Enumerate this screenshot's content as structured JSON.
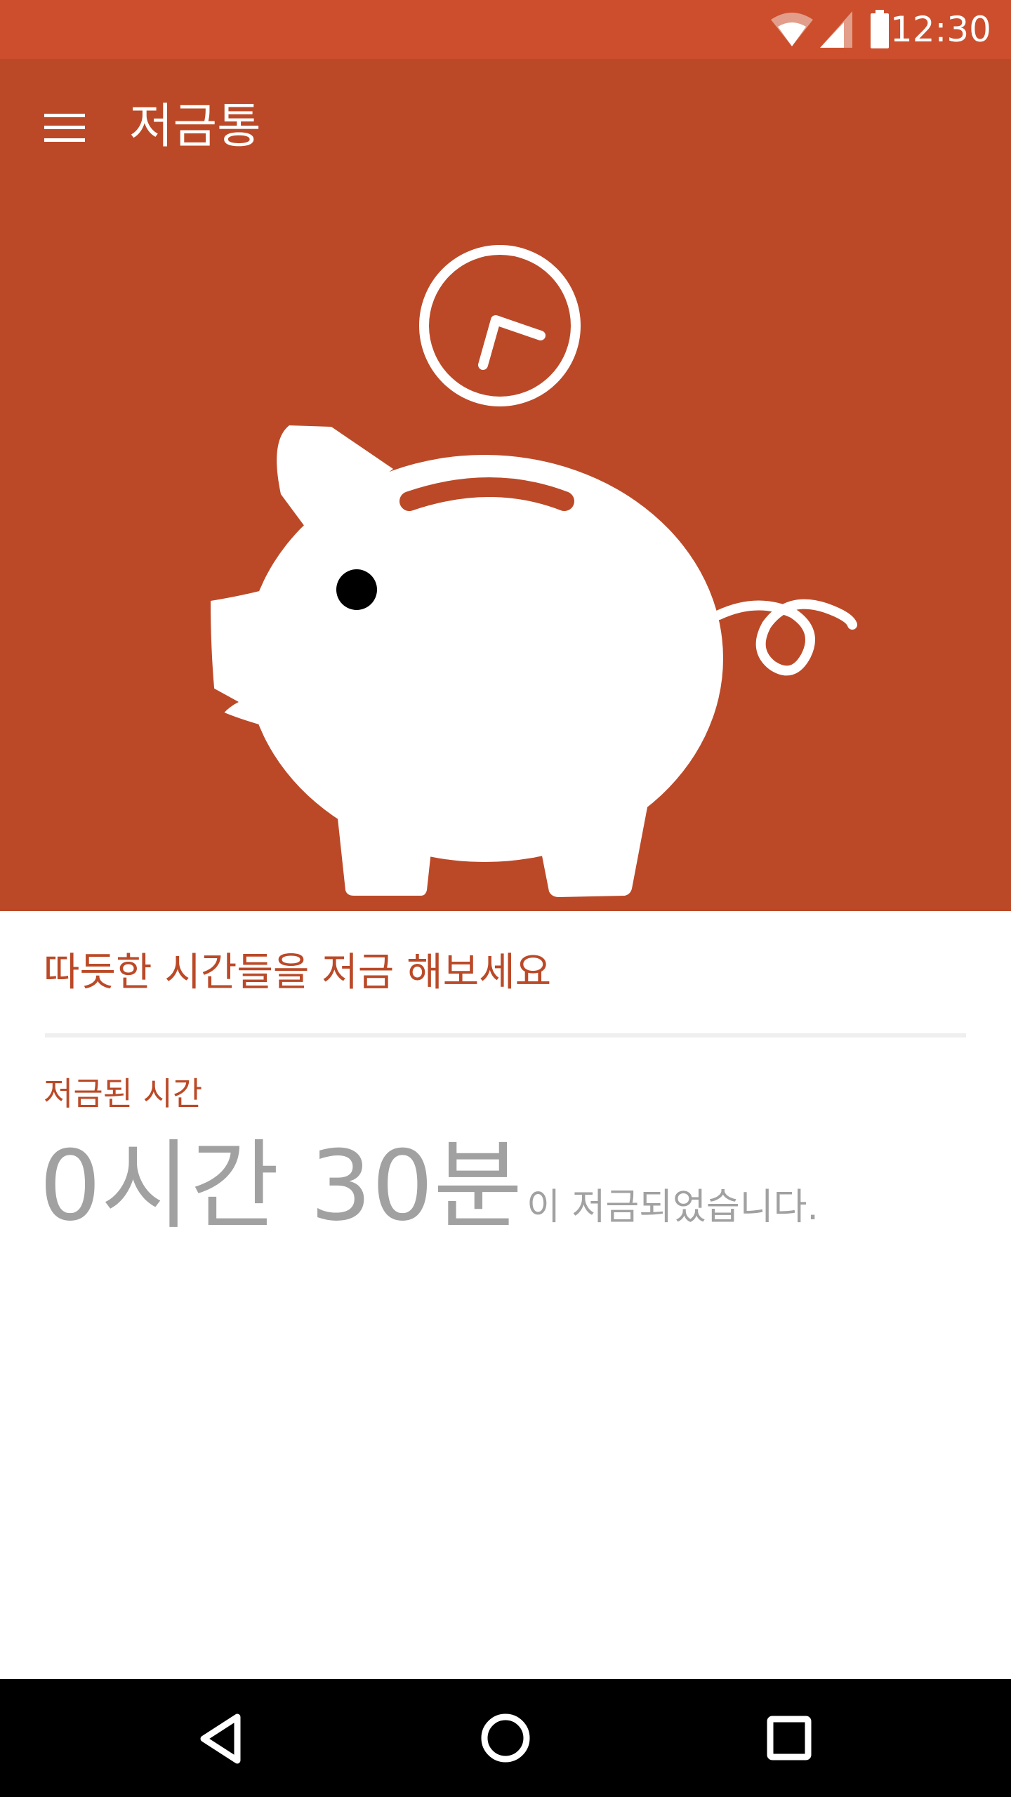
{
  "status_bar": {
    "time": "12:30",
    "icons": [
      "wifi-icon",
      "cellular-signal-icon",
      "battery-icon"
    ],
    "background": "#CC4E2C"
  },
  "app_bar": {
    "title": "저금통",
    "menu_icon": "menu-icon",
    "background": "#BB4927"
  },
  "hero": {
    "illustration": "piggy-bank-with-clock"
  },
  "content": {
    "prompt": "따듯한 시간들을 저금 해보세요",
    "saved_label": "저금된 시간",
    "saved_value": "0시간 30분",
    "saved_suffix": "이 저금되었습니다.",
    "accent_color": "#BB4927",
    "value_color": "#A1A1A1"
  },
  "nav_bar": {
    "buttons": [
      "back-icon",
      "home-icon",
      "recents-icon"
    ]
  }
}
